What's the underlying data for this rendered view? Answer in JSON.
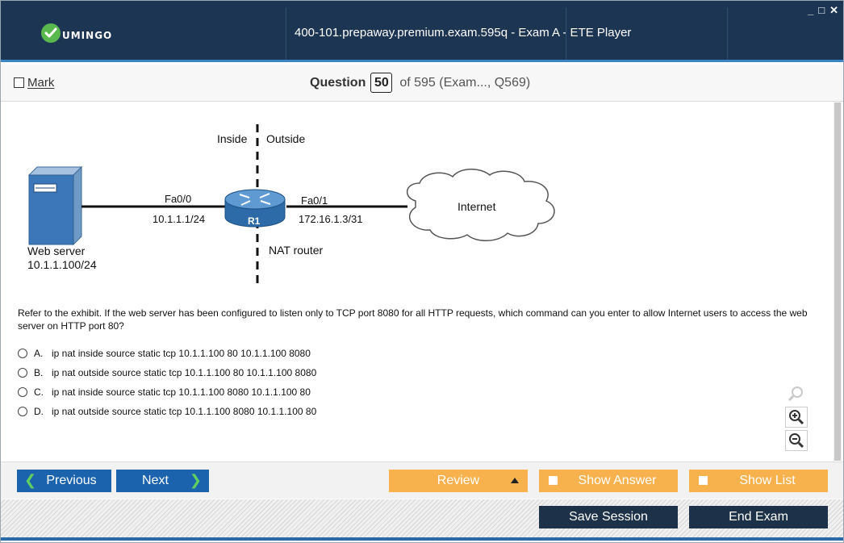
{
  "window": {
    "title": "400-101.prepaway.premium.exam.595q - Exam A - ETE Player",
    "logo_text": "UMINGO",
    "controls": [
      "_",
      "□",
      "✕"
    ]
  },
  "header": {
    "mark_label": "Mark",
    "question_label": "Question",
    "question_number": "50",
    "question_of": "of 595 (Exam..., Q569)"
  },
  "exhibit": {
    "inside_label": "Inside",
    "outside_label": "Outside",
    "server_name": "Web server",
    "server_ip": "10.1.1.100/24",
    "fa00_label": "Fa0/0",
    "fa00_ip": "10.1.1.1/24",
    "router_label": "R1",
    "fa01_label": "Fa0/1",
    "fa01_ip": "172.16.1.3/31",
    "nat_label": "NAT router",
    "internet_label": "Internet"
  },
  "question": {
    "text": "Refer to the exhibit. If the web server has been configured to listen only to TCP port 8080 for all HTTP requests, which command can you enter to allow Internet users to access the web server on HTTP port 80?",
    "options": [
      {
        "letter": "A.",
        "text": "ip nat inside source static tcp 10.1.1.100 80 10.1.1.100 8080"
      },
      {
        "letter": "B.",
        "text": "ip nat outside source static tcp 10.1.1.100 80 10.1.1.100 8080"
      },
      {
        "letter": "C.",
        "text": "ip nat inside source static tcp 10.1.1.100 8080 10.1.1.100 80"
      },
      {
        "letter": "D.",
        "text": "ip nat outside source static tcp 10.1.1.100 8080 10.1.1.100 80"
      }
    ]
  },
  "nav": {
    "previous": "Previous",
    "next": "Next",
    "review": "Review",
    "show_answer": "Show Answer",
    "show_list": "Show List",
    "save_session": "Save Session",
    "end_exam": "End Exam"
  },
  "colors": {
    "titlebar": "#1c3552",
    "accent_blue": "#1b64ad",
    "accent_orange": "#f7b24e",
    "dark_navy": "#1d3249",
    "logo_green": "#59b84e"
  }
}
